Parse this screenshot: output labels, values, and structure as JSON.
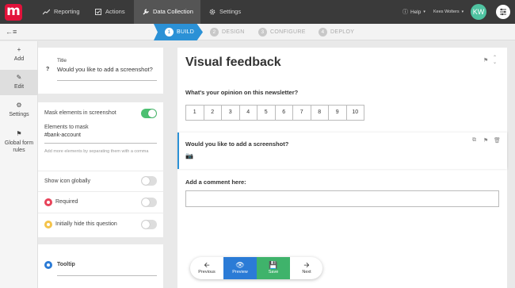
{
  "app": {
    "logo_letter": "m"
  },
  "topnav": {
    "items": [
      {
        "label": "Reporting",
        "icon": "chart-icon"
      },
      {
        "label": "Actions",
        "icon": "check-icon"
      },
      {
        "label": "Data Collection",
        "icon": "wrench-icon",
        "active": true
      },
      {
        "label": "Settings",
        "icon": "gear-icon"
      }
    ],
    "help_label": "Help",
    "user_name": "Kees Wolters",
    "avatar_initials": "KW"
  },
  "steps": [
    {
      "num": "1",
      "label": "BUILD",
      "active": true
    },
    {
      "num": "2",
      "label": "DESIGN"
    },
    {
      "num": "3",
      "label": "CONFIGURE"
    },
    {
      "num": "4",
      "label": "DEPLOY"
    }
  ],
  "sidebar": {
    "items": [
      {
        "label": "Add",
        "icon": "plus-icon"
      },
      {
        "label": "Edit",
        "icon": "pencil-icon",
        "active": true
      },
      {
        "label": "Settings",
        "icon": "gear-icon"
      },
      {
        "label": "Global form rules",
        "icon": "flag-icon"
      }
    ]
  },
  "properties": {
    "title_label": "Title",
    "title_value": "Would you like to add a screenshot?",
    "mask_label": "Mask elements in screenshot",
    "mask_on": true,
    "elements_label": "Elements to mask",
    "elements_value": "#bank-account",
    "elements_hint": "Add more elements by separating them with a comma",
    "show_icon_label": "Show icon globally",
    "required_label": "Required",
    "hide_label": "Initially hide this question",
    "tooltip_label": "Tooltip"
  },
  "canvas": {
    "form_title": "Visual feedback",
    "question1": "What's your opinion on this newsletter?",
    "scale": [
      "1",
      "2",
      "3",
      "4",
      "5",
      "6",
      "7",
      "8",
      "9",
      "10"
    ],
    "question2": "Would you like to add a screenshot?",
    "question3": "Add a comment here:"
  },
  "actions": {
    "previous": "Previous",
    "preview": "Preview",
    "save": "Save",
    "next": "Next"
  },
  "colors": {
    "brand": "#e2123b",
    "accent": "#2b91d6",
    "toggle_on": "#4cc071",
    "required": "#e8435a",
    "hidden": "#f4c34a"
  }
}
